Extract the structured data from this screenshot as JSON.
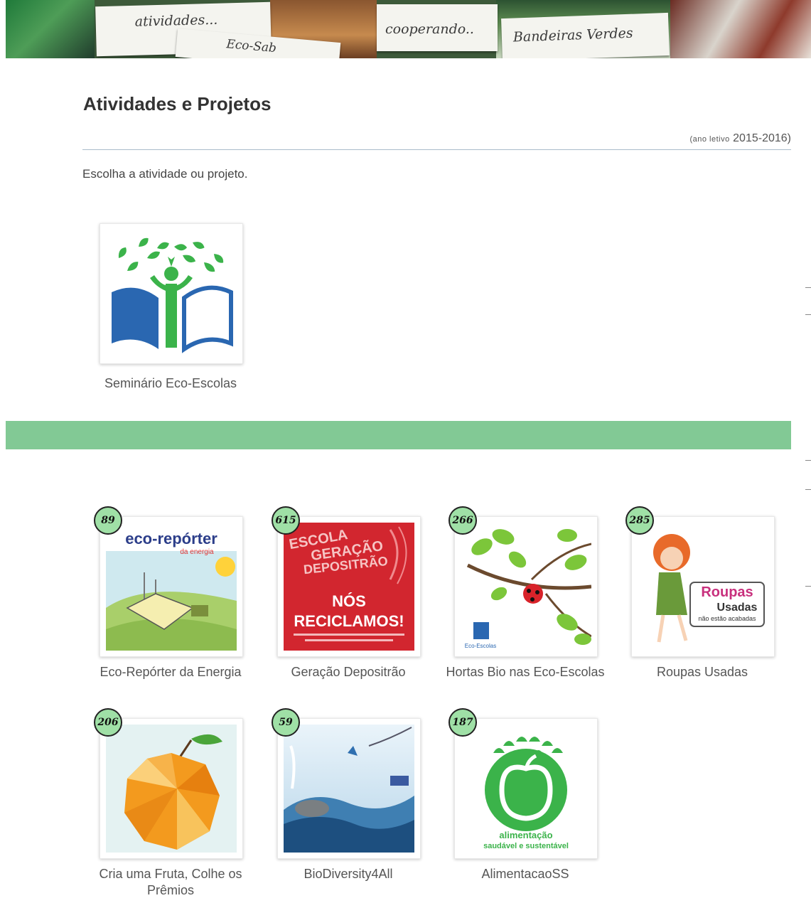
{
  "banner": {
    "cards": [
      "atividades...",
      "Eco-Sab",
      "cooperando..",
      "Bandeiras Verdes"
    ]
  },
  "page": {
    "title": "Atividades e Projetos",
    "year_prefix": "(ano letivo",
    "year_range": "2015-2016)",
    "intro": "Escolha a atividade ou projeto."
  },
  "featured": {
    "label": "Seminário Eco-Escolas",
    "icon": "eco-escolas-logo-icon"
  },
  "colors": {
    "accent_green": "#82c995",
    "brand_green": "#3bb34a",
    "brand_blue": "#2a67b1"
  },
  "activities": [
    {
      "label": "Eco-Repórter da Energia",
      "count": "89",
      "icon": "eco-reporter-energy-icon",
      "logo_text": "eco-repórter",
      "logo_sub": "da energia"
    },
    {
      "label": "Geração Depositrão",
      "count": "615",
      "icon": "geracao-depositrao-icon",
      "logo_lines": [
        "ESCOLA",
        "GERAÇÃO",
        "DEPOSITRÃO"
      ],
      "slogan": [
        "NÓS",
        "RECICLAMOS!"
      ]
    },
    {
      "label": "Hortas Bio nas Eco-Escolas",
      "count": "266",
      "icon": "hortas-bio-ladybug-icon",
      "logo_text": "Eco-Escolas"
    },
    {
      "label": "Roupas Usadas",
      "count": "285",
      "icon": "roupas-usadas-icon",
      "logo_text": "Roupas",
      "logo_word": "Usadas",
      "logo_sub": "não estão acabadas"
    },
    {
      "label": "Cria uma Fruta, Colhe os Prêmios",
      "count": "206",
      "icon": "orange-fruit-icon"
    },
    {
      "label": "BioDiversity4All",
      "count": "59",
      "icon": "biodiversity-nature-icon"
    },
    {
      "label": "AlimentacaoSS",
      "count": "187",
      "icon": "alimentacao-apple-icon",
      "logo_lines": [
        "alimentação",
        "saudável e sustentável"
      ]
    }
  ]
}
